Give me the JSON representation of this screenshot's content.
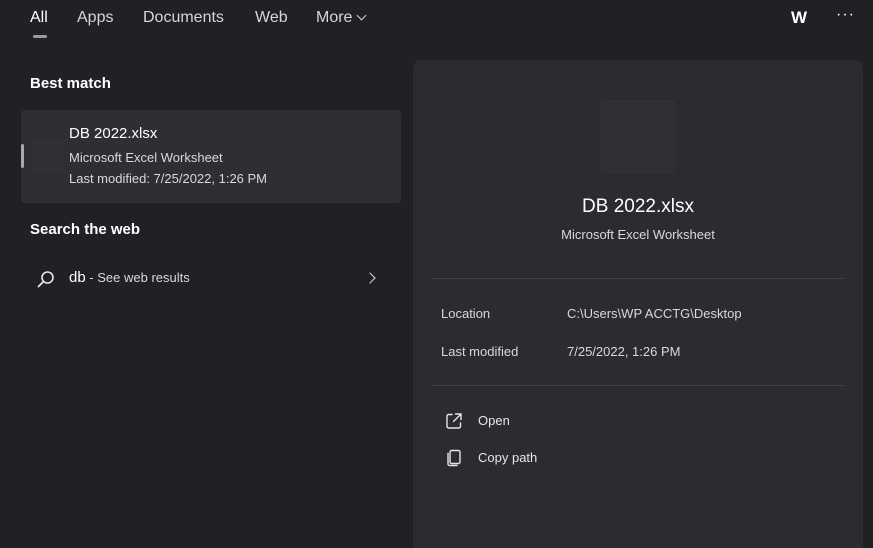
{
  "tabs": {
    "all": "All",
    "apps": "Apps",
    "documents": "Documents",
    "web": "Web",
    "more": "More"
  },
  "header": {
    "avatar_initial": "W",
    "more_options": "···"
  },
  "best_match": {
    "title": "Best match",
    "file_name": "DB 2022.xlsx",
    "file_type": "Microsoft Excel Worksheet",
    "last_modified": "Last modified: 7/25/2022, 1:26 PM"
  },
  "search_web": {
    "title": "Search the web",
    "query": "db",
    "hint": " - See web results"
  },
  "preview": {
    "file_name": "DB 2022.xlsx",
    "file_type": "Microsoft Excel Worksheet",
    "location_label": "Location",
    "location_value": "C:\\Users\\WP ACCTG\\Desktop",
    "modified_label": "Last modified",
    "modified_value": "7/25/2022, 1:26 PM",
    "actions": {
      "open": "Open",
      "copy_path": "Copy path"
    }
  },
  "colors": {
    "background": "#202124",
    "panel": "#2b2c30",
    "card_highlight": "#2e2f33",
    "text": "#ffffff",
    "subtext": "#d9d9d9"
  },
  "icons": [
    "search-icon",
    "chevron-right-icon",
    "chevron-down-icon",
    "open-external-icon",
    "copy-icon",
    "more-dots-icon"
  ]
}
